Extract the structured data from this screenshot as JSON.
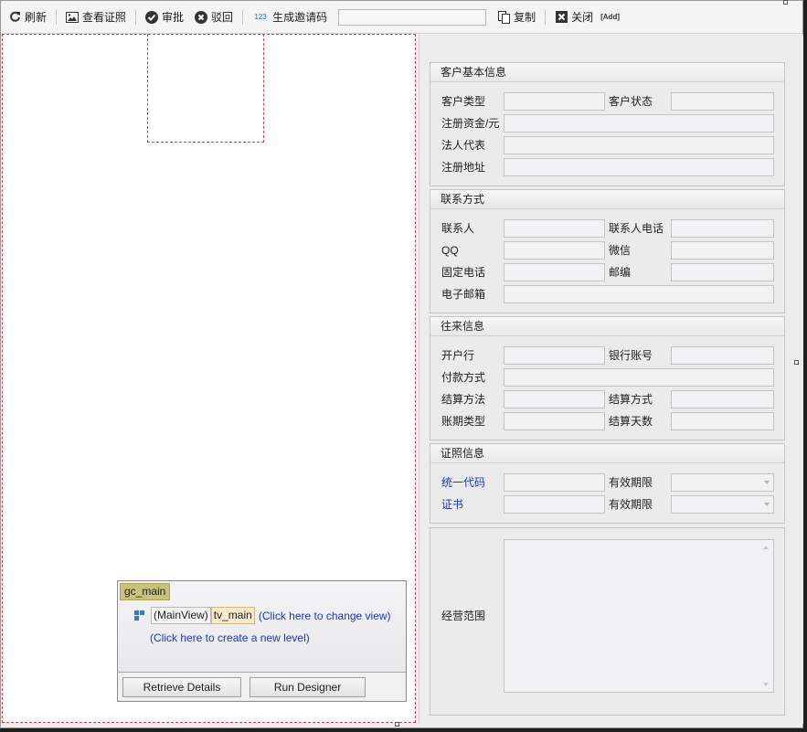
{
  "toolbar": {
    "refresh": "刷新",
    "view_cert": "查看证照",
    "approve": "审批",
    "reject": "驳回",
    "gen_code_prefix": "123",
    "gen_code": "生成邀请码",
    "copy": "复制",
    "close": "关闭",
    "add_badge": "[Add]",
    "code_input_value": ""
  },
  "designer": {
    "grid_name": "gc_main",
    "view_type": "(MainView)",
    "view_name": "tv_main",
    "change_view": "(Click here to change view)",
    "new_level": "(Click here to create a new level)",
    "retrieve_details": "Retrieve Details",
    "run_designer": "Run Designer"
  },
  "groups": {
    "basic": {
      "title": "客户基本信息",
      "customer_type": "客户类型",
      "customer_status": "客户状态",
      "reg_capital": "注册资金/元",
      "legal_rep": "法人代表",
      "reg_address": "注册地址"
    },
    "contact": {
      "title": "联系方式",
      "contact_person": "联系人",
      "contact_phone": "联系人电话",
      "qq": "QQ",
      "wechat": "微信",
      "landline": "固定电话",
      "postcode": "邮编",
      "email": "电子邮箱"
    },
    "business": {
      "title": "往来信息",
      "bank": "开户行",
      "bank_account": "银行账号",
      "payment_method": "付款方式",
      "settle_method_a": "结算方法",
      "settle_method_b": "结算方式",
      "term_type": "账期类型",
      "settle_days": "结算天数"
    },
    "license": {
      "title": "证照信息",
      "unified_code": "统一代码",
      "validity_1": "有效期限",
      "certificate": "证书",
      "validity_2": "有效期限"
    },
    "scope": {
      "label": "经营范围"
    }
  },
  "colors": {
    "accent_link": "#1a35c9",
    "canvas_border": "#e03a3a",
    "grid_tag": "#c9c37a"
  }
}
